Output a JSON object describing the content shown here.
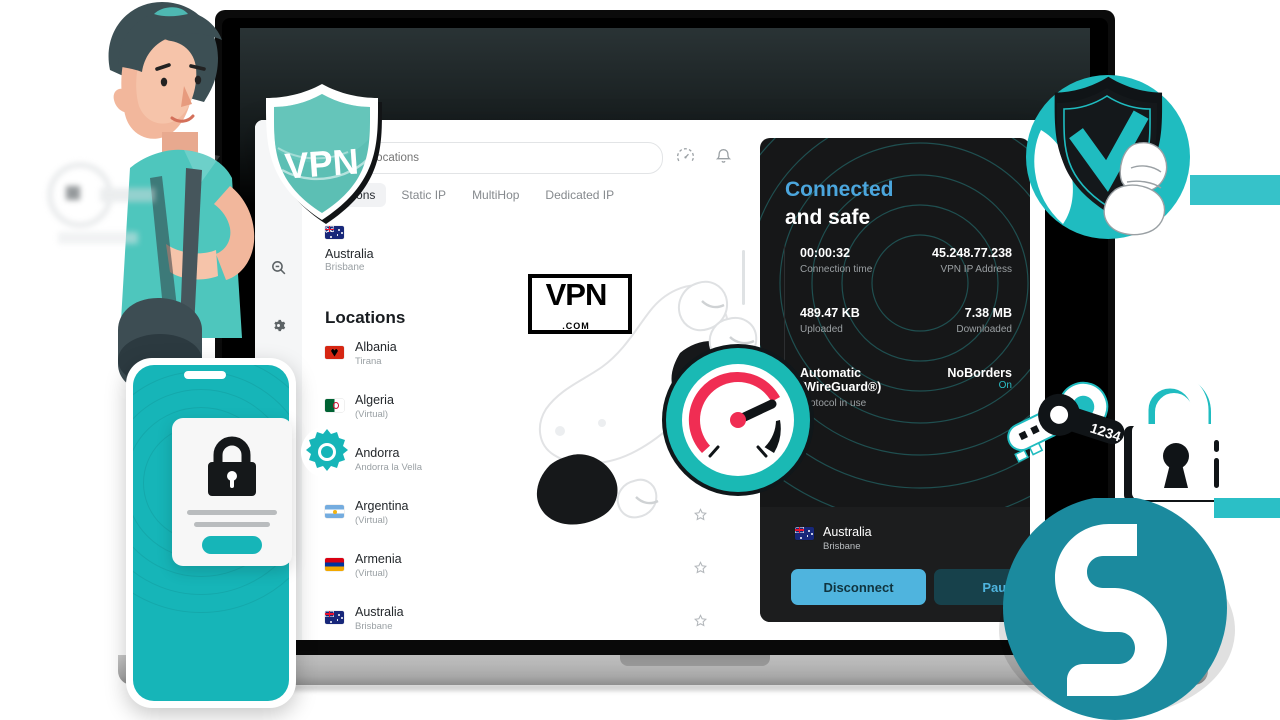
{
  "brand": {
    "watermark_main": "VPN",
    "watermark_sub": ".COM",
    "logo_name": "surfshark-logo"
  },
  "colors": {
    "teal": "#2BBFC6",
    "phone_teal": "#16B5B8",
    "surfshark_teal": "#1B8A9E",
    "panel_bg": "#161718",
    "connected_blue": "#4BA6DD",
    "button_blue": "#4FB4DE",
    "speedo_red": "#F02D53"
  },
  "app": {
    "search": {
      "placeholder": "Search locations",
      "value": ""
    },
    "header_icons": [
      {
        "name": "speed-test-icon"
      },
      {
        "name": "notifications-bell-icon"
      }
    ],
    "sidebar_icons": [
      {
        "name": "search-icon"
      },
      {
        "name": "settings-gear-icon"
      }
    ],
    "tabs": [
      {
        "label": "Locations",
        "active": true
      },
      {
        "label": "Static IP",
        "active": false
      },
      {
        "label": "MultiHop",
        "active": false
      },
      {
        "label": "Dedicated IP",
        "active": false
      }
    ],
    "quick_connect": {
      "country": "Australia",
      "city": "Brisbane",
      "flag": "australia"
    },
    "section_title": "Locations",
    "locations": [
      {
        "country": "Albania",
        "sub": "Tirana",
        "flag": "albania"
      },
      {
        "country": "Algeria",
        "sub": "(Virtual)",
        "flag": "algeria"
      },
      {
        "country": "Andorra",
        "sub": "Andorra la Vella",
        "flag": "andorra"
      },
      {
        "country": "Argentina",
        "sub": "(Virtual)",
        "flag": "argentina"
      },
      {
        "country": "Armenia",
        "sub": "(Virtual)",
        "flag": "armenia"
      },
      {
        "country": "Australia",
        "sub": "Brisbane",
        "flag": "australia"
      }
    ]
  },
  "panel": {
    "status_line1": "Connected",
    "status_line2": "and safe",
    "stats": [
      {
        "value": "00:00:32",
        "label": "Connection time"
      },
      {
        "value": "45.248.77.238",
        "label": "VPN IP Address"
      },
      {
        "value": "489.47 KB",
        "label": "Uploaded"
      },
      {
        "value": "7.38 MB",
        "label": "Downloaded"
      }
    ],
    "protocol": {
      "value_line1": "Automatic",
      "value_line2": "(WireGuard®)",
      "label": "Protocol in use"
    },
    "noborders": {
      "value": "NoBorders",
      "state": "On"
    },
    "footer": {
      "country": "Australia",
      "city": "Brisbane",
      "disconnect_label": "Disconnect",
      "pause_label": "Pause"
    }
  },
  "decorations": {
    "keys": {
      "asterisks": "✱✱✱✱",
      "code": "1234"
    },
    "shield_badge": "shield-check-icon",
    "padlock": "padlock-icon",
    "speedometer": "speedometer-icon",
    "phone_lock": "lock-icon",
    "gear": "gear-icon"
  }
}
